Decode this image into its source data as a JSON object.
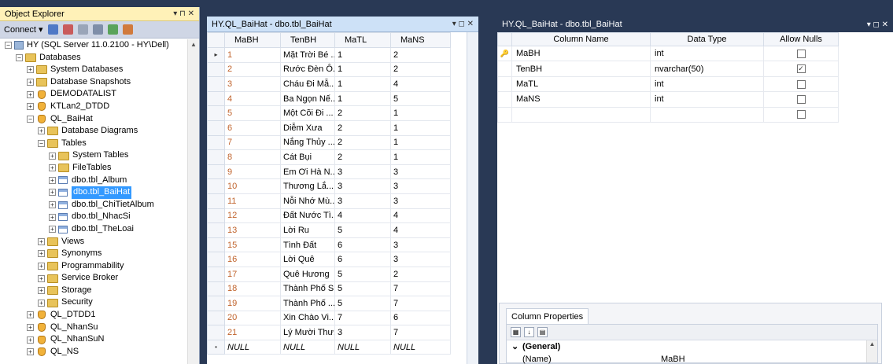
{
  "object_explorer": {
    "title": "Object Explorer",
    "pin": "▾ ⊓ ✕",
    "connect_label": "Connect ▾",
    "tree": [
      {
        "depth": 0,
        "exp": "−",
        "icon": "server",
        "label": "HY (SQL Server 11.0.2100 - HY\\Dell)"
      },
      {
        "depth": 1,
        "exp": "−",
        "icon": "folder",
        "label": "Databases"
      },
      {
        "depth": 2,
        "exp": "+",
        "icon": "folder",
        "label": "System Databases"
      },
      {
        "depth": 2,
        "exp": "+",
        "icon": "folder",
        "label": "Database Snapshots"
      },
      {
        "depth": 2,
        "exp": "+",
        "icon": "db",
        "label": "DEMODATALIST"
      },
      {
        "depth": 2,
        "exp": "+",
        "icon": "db",
        "label": "KTLan2_DTDD"
      },
      {
        "depth": 2,
        "exp": "−",
        "icon": "db",
        "label": "QL_BaiHat"
      },
      {
        "depth": 3,
        "exp": "+",
        "icon": "folder",
        "label": "Database Diagrams"
      },
      {
        "depth": 3,
        "exp": "−",
        "icon": "folder",
        "label": "Tables"
      },
      {
        "depth": 4,
        "exp": "+",
        "icon": "folder",
        "label": "System Tables"
      },
      {
        "depth": 4,
        "exp": "+",
        "icon": "folder",
        "label": "FileTables"
      },
      {
        "depth": 4,
        "exp": "+",
        "icon": "table",
        "label": "dbo.tbl_Album"
      },
      {
        "depth": 4,
        "exp": "+",
        "icon": "table",
        "label": "dbo.tbl_BaiHat",
        "selected": true
      },
      {
        "depth": 4,
        "exp": "+",
        "icon": "table",
        "label": "dbo.tbl_ChiTietAlbum"
      },
      {
        "depth": 4,
        "exp": "+",
        "icon": "table",
        "label": "dbo.tbl_NhacSi"
      },
      {
        "depth": 4,
        "exp": "+",
        "icon": "table",
        "label": "dbo.tbl_TheLoai"
      },
      {
        "depth": 3,
        "exp": "+",
        "icon": "folder",
        "label": "Views"
      },
      {
        "depth": 3,
        "exp": "+",
        "icon": "folder",
        "label": "Synonyms"
      },
      {
        "depth": 3,
        "exp": "+",
        "icon": "folder",
        "label": "Programmability"
      },
      {
        "depth": 3,
        "exp": "+",
        "icon": "folder",
        "label": "Service Broker"
      },
      {
        "depth": 3,
        "exp": "+",
        "icon": "folder",
        "label": "Storage"
      },
      {
        "depth": 3,
        "exp": "+",
        "icon": "folder",
        "label": "Security"
      },
      {
        "depth": 2,
        "exp": "+",
        "icon": "db",
        "label": "QL_DTDD1"
      },
      {
        "depth": 2,
        "exp": "+",
        "icon": "db",
        "label": "QL_NhanSu"
      },
      {
        "depth": 2,
        "exp": "+",
        "icon": "db",
        "label": "QL_NhanSuN"
      },
      {
        "depth": 2,
        "exp": "+",
        "icon": "db",
        "label": "QL_NS"
      }
    ]
  },
  "data_grid": {
    "title": "HY.QL_BaiHat - dbo.tbl_BaiHat",
    "controls": "▾ ◻ ✕",
    "columns": [
      "MaBH",
      "TenBH",
      "MaTL",
      "MaNS"
    ],
    "current_row_marker": "▸",
    "new_row_marker": "•",
    "rows": [
      [
        "1",
        "Mặt Trời Bé ...",
        "1",
        "2"
      ],
      [
        "2",
        "Rước Đèn Ô...",
        "1",
        "2"
      ],
      [
        "3",
        "Cháu Đi Mẫ...",
        "1",
        "4"
      ],
      [
        "4",
        "Ba Ngọn Nế...",
        "1",
        "5"
      ],
      [
        "5",
        "Một Cõi Đi ...",
        "2",
        "1"
      ],
      [
        "6",
        "Diễm Xưa",
        "2",
        "1"
      ],
      [
        "7",
        "Nắng Thủy ...",
        "2",
        "1"
      ],
      [
        "8",
        "Cát Bụi",
        "2",
        "1"
      ],
      [
        "9",
        "Em Ơi Hà N...",
        "3",
        "3"
      ],
      [
        "10",
        "Thương Lắ...",
        "3",
        "3"
      ],
      [
        "11",
        "Nỗi Nhớ Mù...",
        "3",
        "3"
      ],
      [
        "12",
        "Đất Nước Tì...",
        "4",
        "4"
      ],
      [
        "13",
        "Lời Ru",
        "5",
        "4"
      ],
      [
        "15",
        "Tình Đất",
        "6",
        "3"
      ],
      [
        "16",
        "Lời Quê",
        "6",
        "3"
      ],
      [
        "17",
        "Quê Hương",
        "5",
        "2"
      ],
      [
        "18",
        "Thành Phố S...",
        "5",
        "7"
      ],
      [
        "19",
        "Thành Phố ...",
        "5",
        "7"
      ],
      [
        "20",
        "Xin Chào Vi...",
        "7",
        "6"
      ],
      [
        "21",
        "Lý Mười Thư...",
        "3",
        "7"
      ]
    ],
    "null_row": [
      "NULL",
      "NULL",
      "NULL",
      "NULL"
    ]
  },
  "designer": {
    "title": "HY.QL_BaiHat - dbo.tbl_BaiHat",
    "controls": "▾ ◻ ✕",
    "headers": [
      "Column Name",
      "Data Type",
      "Allow Nulls"
    ],
    "key_marker": "🔑",
    "columns": [
      {
        "name": "MaBH",
        "type": "int",
        "nulls": false,
        "key": true
      },
      {
        "name": "TenBH",
        "type": "nvarchar(50)",
        "nulls": true,
        "key": false
      },
      {
        "name": "MaTL",
        "type": "int",
        "nulls": false,
        "key": false
      },
      {
        "name": "MaNS",
        "type": "int",
        "nulls": false,
        "key": false
      },
      {
        "name": "",
        "type": "",
        "nulls": false,
        "key": false
      }
    ],
    "column_properties": {
      "tab_label": "Column Properties",
      "group": "(General)",
      "prop_name": "(Name)",
      "prop_value": "MaBH"
    }
  },
  "colors": {
    "chrome": "#293955",
    "selection": "#3399ff",
    "id_text": "#c0632c"
  }
}
